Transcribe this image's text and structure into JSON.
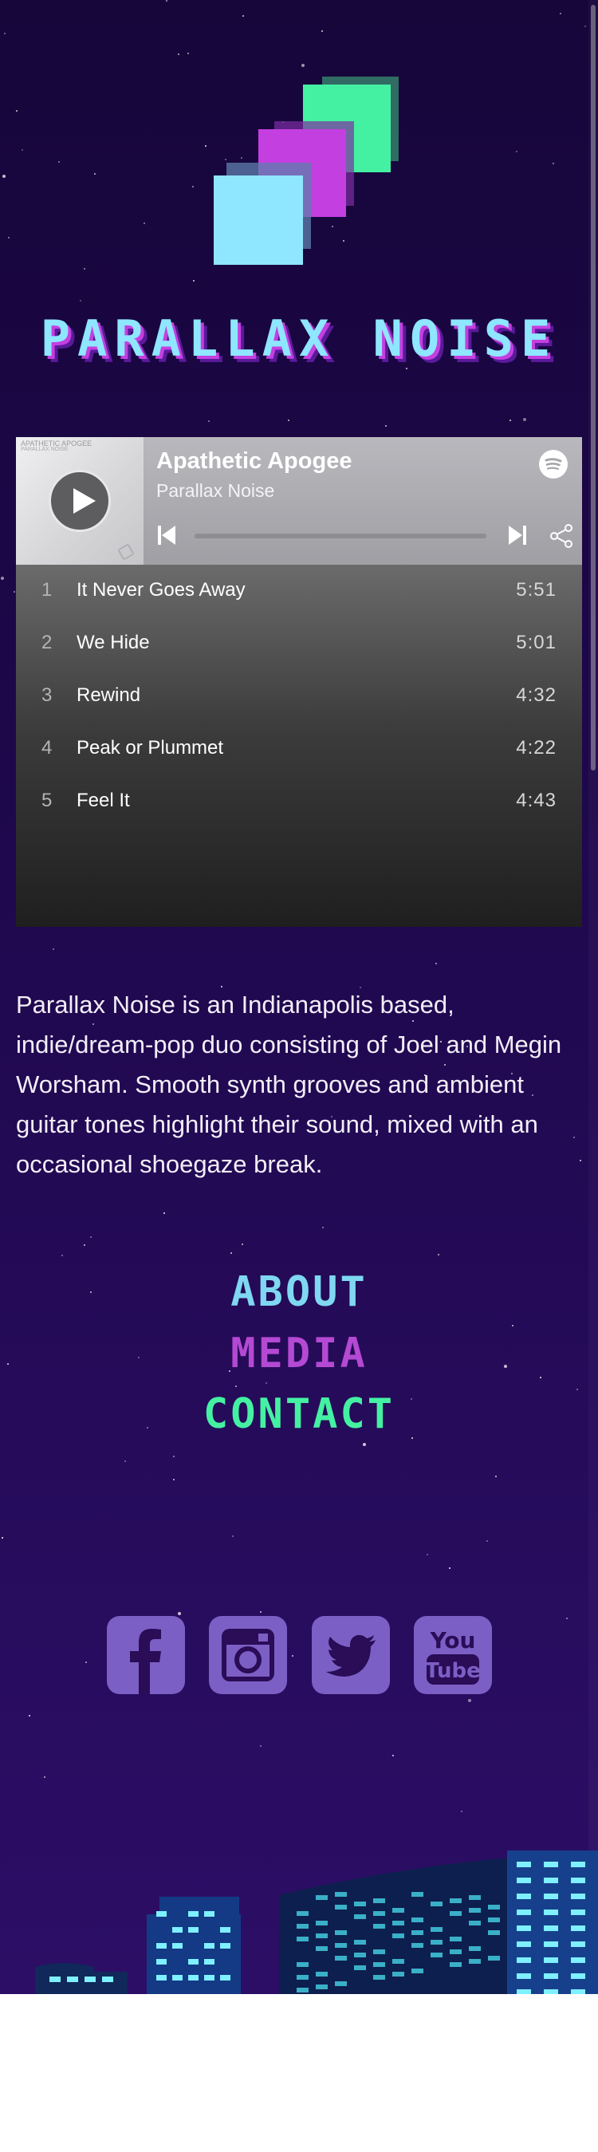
{
  "brand": {
    "title": "PARALLAX NOISE"
  },
  "player": {
    "album": "Apathetic Apogee",
    "artist": "Parallax Noise",
    "cover_text": "APATHETIC APOGEE",
    "cover_subtext": "PARALLAX NOISE",
    "tracks": [
      {
        "num": "1",
        "name": "It Never Goes Away",
        "duration": "5:51"
      },
      {
        "num": "2",
        "name": "We Hide",
        "duration": "5:01"
      },
      {
        "num": "3",
        "name": "Rewind",
        "duration": "4:32"
      },
      {
        "num": "4",
        "name": "Peak or Plummet",
        "duration": "4:22"
      },
      {
        "num": "5",
        "name": "Feel It",
        "duration": "4:43"
      }
    ],
    "icons": [
      "play-icon",
      "spotify-icon",
      "previous-track-icon",
      "next-track-icon",
      "share-icon"
    ],
    "progress": 0
  },
  "bio": "Parallax Noise is an Indianapolis based, indie/dream-pop duo consisting of Joel and Megin Worsham. Smooth synth grooves and ambient guitar tones highlight their sound, mixed with an occasional shoegaze break.",
  "nav": {
    "about": "ABOUT",
    "media": "MEDIA",
    "contact": "CONTACT"
  },
  "social": [
    "facebook-icon",
    "instagram-icon",
    "twitter-icon",
    "youtube-icon"
  ],
  "youtube_icon_text": {
    "top": "You",
    "bottom": "Tube"
  },
  "colors": {
    "background": "#1c0747",
    "title": "#8ee6ff",
    "title_shadow": "#c43fe0",
    "about": "#7fd7f2",
    "media": "#b449d3",
    "contact": "#44f1a2",
    "social": "#7b5fc4",
    "logo_squares": [
      "#8ee6ff",
      "#c43fe0",
      "#44f1a2"
    ]
  }
}
